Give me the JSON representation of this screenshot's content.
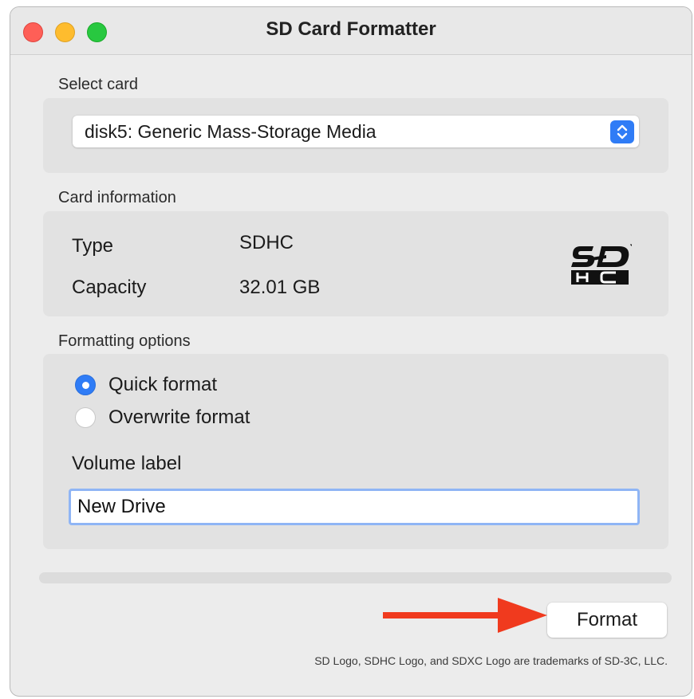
{
  "window": {
    "title": "SD Card Formatter"
  },
  "select_card": {
    "label": "Select card",
    "selected": "disk5: Generic Mass-Storage Media"
  },
  "card_info": {
    "label": "Card information",
    "type_label": "Type",
    "type_value": "SDHC",
    "capacity_label": "Capacity",
    "capacity_value": "32.01 GB",
    "logo_icon": "sdhc-logo-icon"
  },
  "formatting": {
    "label": "Formatting options",
    "options": [
      {
        "label": "Quick format",
        "checked": true
      },
      {
        "label": "Overwrite format",
        "checked": false
      }
    ],
    "volume_label_title": "Volume label",
    "volume_label_value": "New Drive"
  },
  "progress": {
    "value": 0
  },
  "actions": {
    "format_label": "Format"
  },
  "footer": {
    "text": "SD Logo, SDHC Logo, and SDXC Logo are trademarks of SD-3C, LLC."
  },
  "colors": {
    "accent": "#2f7cf6",
    "annotation_arrow": "#f03a1e"
  }
}
